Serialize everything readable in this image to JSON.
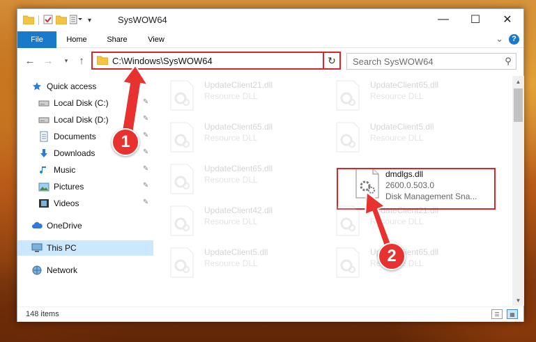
{
  "window": {
    "title": "SysWOW64",
    "controls": {
      "minimize": "—",
      "maximize": "☐",
      "close": "✕"
    }
  },
  "ribbon": {
    "tabs": [
      "File",
      "Home",
      "Share",
      "View"
    ],
    "expand": "⌄",
    "help": "?"
  },
  "navigation": {
    "back": "←",
    "forward": "→",
    "recent": "▾",
    "up": "↑",
    "address_path": "C:\\Windows\\SysWOW64",
    "address_dropdown": "⌄",
    "refresh": "↻",
    "search_placeholder": "Search SysWOW64",
    "search_icon": "⚲"
  },
  "sidebar": {
    "items": [
      {
        "label": "Quick access",
        "icon": "star-icon",
        "pinned": false
      },
      {
        "label": "Local Disk (C:)",
        "icon": "drive-icon",
        "pinned": true
      },
      {
        "label": "Local Disk (D:)",
        "icon": "drive-icon",
        "pinned": true
      },
      {
        "label": "Documents",
        "icon": "documents-icon",
        "pinned": true
      },
      {
        "label": "Downloads",
        "icon": "downloads-icon",
        "pinned": true
      },
      {
        "label": "Music",
        "icon": "music-icon",
        "pinned": true
      },
      {
        "label": "Pictures",
        "icon": "pictures-icon",
        "pinned": true
      },
      {
        "label": "Videos",
        "icon": "videos-icon",
        "pinned": true
      },
      {
        "label": "OneDrive",
        "icon": "cloud-icon",
        "pinned": false
      },
      {
        "label": "This PC",
        "icon": "computer-icon",
        "pinned": false,
        "selected": true
      },
      {
        "label": "Network",
        "icon": "network-icon",
        "pinned": false
      }
    ],
    "pin_glyph": "📌"
  },
  "files": {
    "left_column": [
      {
        "name": "UpdateClient21.dll",
        "desc": "Resource DLL"
      },
      {
        "name": "UpdateClient65.dll",
        "desc": "Resource DLL"
      },
      {
        "name": "UpdateClient65.dll",
        "desc": "Resource DLL"
      },
      {
        "name": "UpdateClient42.dll",
        "desc": "Resource DLL"
      },
      {
        "name": "UpdateClient5.dll",
        "desc": "Resource DLL"
      }
    ],
    "right_column": [
      {
        "name": "UpdateClient65.dll",
        "desc": "Resource DLL"
      },
      {
        "name": "UpdateClient5.dll",
        "desc": "Resource DLL"
      },
      {
        "name": "dmdlgs.dll",
        "desc": "2600.0.503.0",
        "desc2": "Disk Management Sna...",
        "highlighted": true
      },
      {
        "name": "UpdateClient21.dll",
        "desc": "Resource DLL"
      },
      {
        "name": "UpdateClient65.dll",
        "desc": "Resource DLL"
      }
    ]
  },
  "status": {
    "item_count": "148 items"
  },
  "callouts": {
    "step1": "1",
    "step2": "2",
    "color": "#e8322f"
  }
}
